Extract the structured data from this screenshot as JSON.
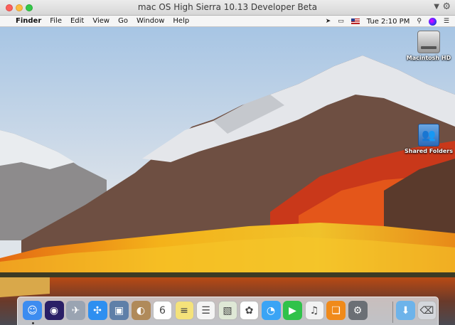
{
  "window": {
    "title": "mac OS High Sierra 10.13 Developer Beta"
  },
  "menubar": {
    "apple_glyph": "",
    "items": [
      "Finder",
      "File",
      "Edit",
      "View",
      "Go",
      "Window",
      "Help"
    ],
    "clock": "Tue 2:10 PM"
  },
  "status_icons": [
    "location-icon",
    "screen-mirroring-icon",
    "flag-icon",
    "search-icon",
    "siri-icon",
    "menu-list-icon"
  ],
  "desktop_icons": [
    {
      "label": "Macintosh HD",
      "icon": "hard-drive-icon"
    },
    {
      "label": "Shared Folders",
      "icon": "shared-folder-icon"
    }
  ],
  "dock": {
    "apps": [
      {
        "name": "finder-icon",
        "color": "#3d8cf0",
        "glyph": "☺"
      },
      {
        "name": "siri-icon",
        "color": "#2a1f66",
        "glyph": "◉"
      },
      {
        "name": "launchpad-icon",
        "color": "#9aa4b2",
        "glyph": "✈"
      },
      {
        "name": "safari-icon",
        "color": "#2e8ff0",
        "glyph": "✣"
      },
      {
        "name": "photo-browser-icon",
        "color": "#5f7fa8",
        "glyph": "▣"
      },
      {
        "name": "contacts-icon",
        "color": "#b08a5a",
        "glyph": "◐"
      },
      {
        "name": "calendar-icon",
        "color": "#ffffff",
        "glyph": "6"
      },
      {
        "name": "notes-icon",
        "color": "#f5e27a",
        "glyph": "≡"
      },
      {
        "name": "reminders-icon",
        "color": "#f4f4f4",
        "glyph": "☰"
      },
      {
        "name": "preview-icon",
        "color": "#dfe8d6",
        "glyph": "▧"
      },
      {
        "name": "photos-icon",
        "color": "#ffffff",
        "glyph": "✿"
      },
      {
        "name": "messages-icon",
        "color": "#3aa4f5",
        "glyph": "◔"
      },
      {
        "name": "facetime-icon",
        "color": "#30c24a",
        "glyph": "▶"
      },
      {
        "name": "itunes-icon",
        "color": "#f2f2f2",
        "glyph": "♫"
      },
      {
        "name": "ibooks-icon",
        "color": "#f08a1a",
        "glyph": "❏"
      },
      {
        "name": "system-preferences-icon",
        "color": "#6b6f75",
        "glyph": "⚙"
      },
      {
        "name": "downloads-folder-icon",
        "color": "#6db3ea",
        "glyph": "⬇"
      },
      {
        "name": "trash-icon",
        "color": "#d4d7dc",
        "glyph": "⌫"
      }
    ]
  }
}
